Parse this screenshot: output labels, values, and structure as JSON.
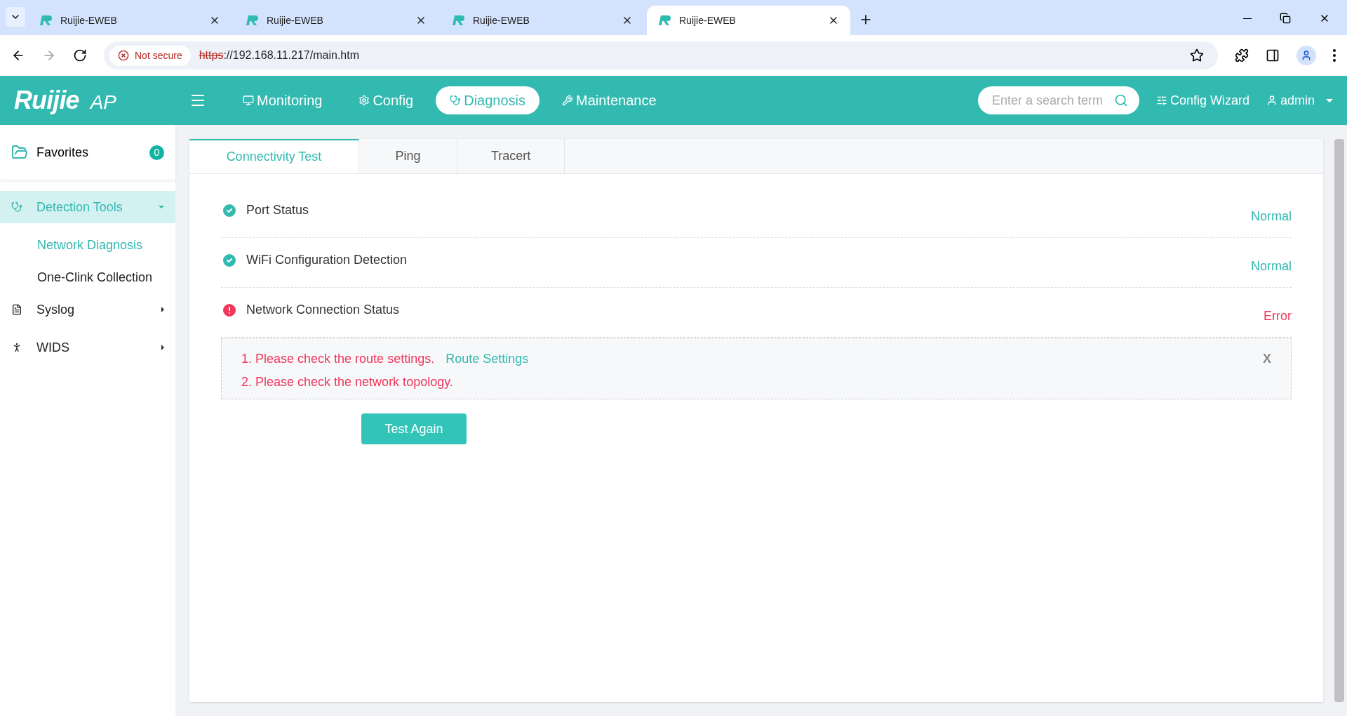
{
  "browser": {
    "tabs": [
      {
        "title": "Ruijie-EWEB",
        "selected": false
      },
      {
        "title": "Ruijie-EWEB",
        "selected": false
      },
      {
        "title": "Ruijie-EWEB",
        "selected": false
      },
      {
        "title": "Ruijie-EWEB",
        "selected": true
      }
    ],
    "security": "Not secure",
    "url_scheme": "https",
    "url_rest": "://192.168.11.217/main.htm"
  },
  "header": {
    "logo": "Ruijie",
    "logo_suffix": "AP",
    "nav": [
      {
        "label": "Monitoring",
        "selected": false
      },
      {
        "label": "Config",
        "selected": false
      },
      {
        "label": "Diagnosis",
        "selected": true
      },
      {
        "label": "Maintenance",
        "selected": false
      }
    ],
    "search": {
      "placeholder": "Enter a search term"
    },
    "wizard": "Config Wizard",
    "user": "admin"
  },
  "sidebar": {
    "favorites": {
      "label": "Favorites",
      "count": "0"
    },
    "items": [
      {
        "label": "Detection Tools",
        "expanded": true,
        "selected": true,
        "children": [
          {
            "label": "Network Diagnosis",
            "selected": true
          },
          {
            "label": "One-Clink Collection",
            "selected": false
          }
        ]
      },
      {
        "label": "Syslog",
        "expanded": false,
        "selected": false
      },
      {
        "label": "WIDS",
        "expanded": false,
        "selected": false
      }
    ]
  },
  "tabs": [
    {
      "label": "Connectivity Test",
      "selected": true
    },
    {
      "label": "Ping",
      "selected": false
    },
    {
      "label": "Tracert",
      "selected": false
    }
  ],
  "checks": [
    {
      "name": "Port Status",
      "kind": "ok",
      "result": "Normal"
    },
    {
      "name": "WiFi Configuration Detection",
      "kind": "ok",
      "result": "Normal"
    },
    {
      "name": "Network Connection Status",
      "kind": "error",
      "result": "Error"
    }
  ],
  "advice": {
    "lines": [
      "1. Please check the route settings.",
      "2. Please check the network topology."
    ],
    "link": "Route Settings",
    "close": "X"
  },
  "test_button": "Test Again"
}
